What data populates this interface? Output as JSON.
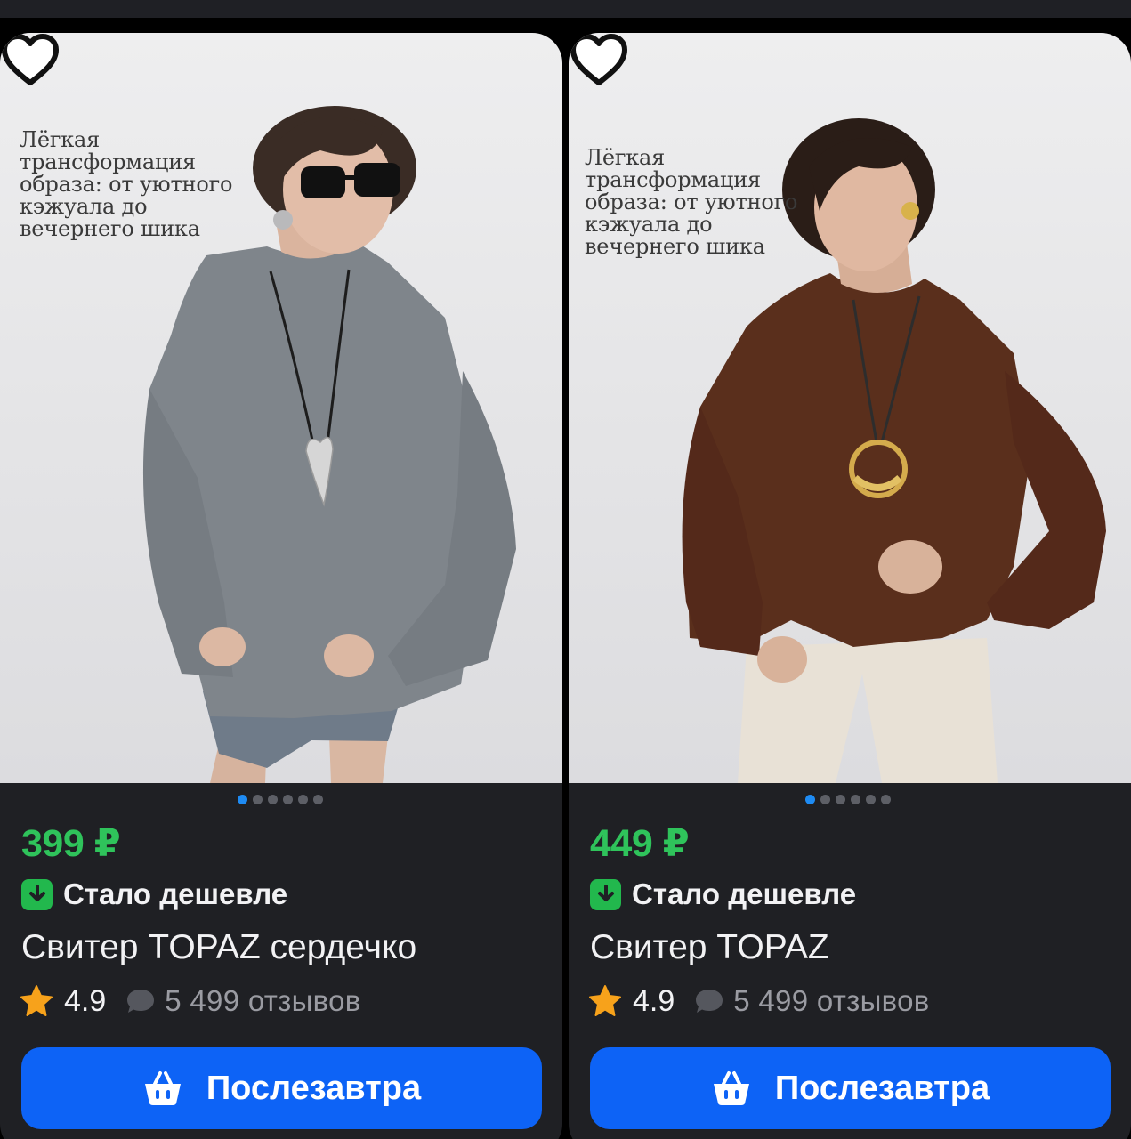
{
  "products": [
    {
      "photo_caption": "Лёгкая трансформация образа: от уютного кэжуала до вечернего шика",
      "price": "399 ₽",
      "badge": "Стало дешевле",
      "title": "Свитер TOPAZ сердечко",
      "rating": "4.9",
      "reviews": "5 499 отзывов",
      "cta_label": "Послезавтра",
      "sweater_color": "#7f858b",
      "pendant": "heart",
      "image_dots": 6,
      "active_dot": 0
    },
    {
      "photo_caption": "Лёгкая трансформация образа: от уютного кэжуала до вечернего шика",
      "price": "449 ₽",
      "badge": "Стало дешевле",
      "title": "Свитер TOPAZ",
      "rating": "4.9",
      "reviews": "5 499 отзывов",
      "cta_label": "Послезавтра",
      "sweater_color": "#5a2f1c",
      "pendant": "ring",
      "image_dots": 6,
      "active_dot": 0
    }
  ],
  "icons": {
    "favorite": "heart-outline-icon",
    "badge": "arrow-down-icon",
    "rating": "star-icon",
    "reviews": "chat-bubble-icon",
    "cta": "basket-icon"
  },
  "colors": {
    "price": "#2fc35b",
    "badge_bg": "#22b84d",
    "cta_bg": "#0d63f6",
    "star": "#f7a21b",
    "dot_active": "#1e8bf3",
    "card_bg": "#1f2024"
  }
}
